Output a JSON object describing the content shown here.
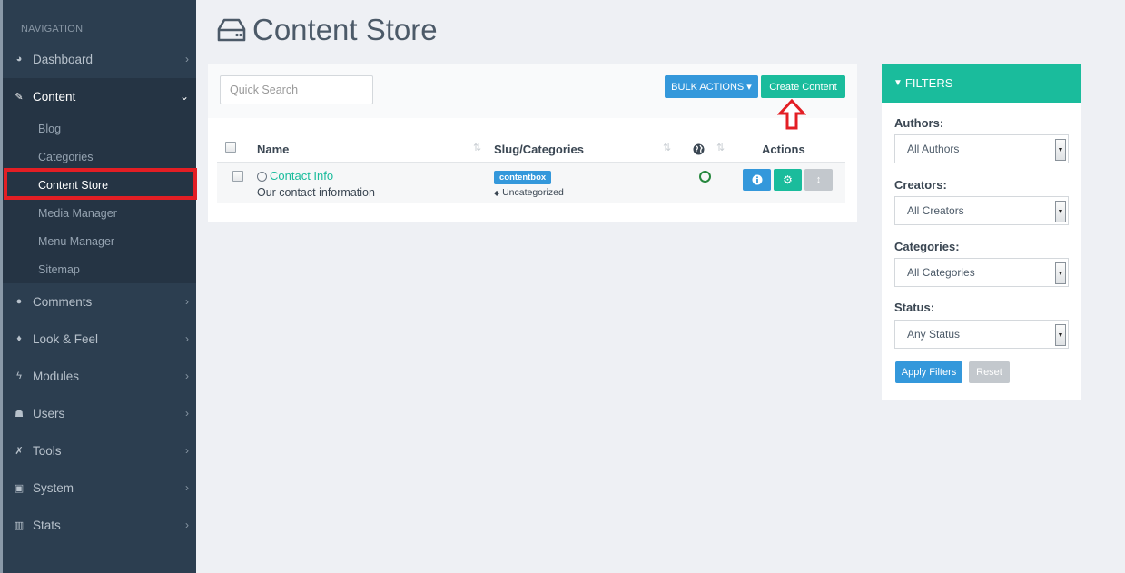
{
  "sidebar": {
    "title": "NAVIGATION",
    "items": [
      {
        "label": "Dashboard",
        "icon": "dashboard-icon",
        "glyph": "◕"
      },
      {
        "label": "Content",
        "icon": "pencil-icon",
        "glyph": "✎"
      },
      {
        "label": "Comments",
        "icon": "comment-icon",
        "glyph": "●"
      },
      {
        "label": "Look & Feel",
        "icon": "tint-icon",
        "glyph": "♦"
      },
      {
        "label": "Modules",
        "icon": "bolt-icon",
        "glyph": "ϟ"
      },
      {
        "label": "Users",
        "icon": "user-icon",
        "glyph": "☗"
      },
      {
        "label": "Tools",
        "icon": "wrench-icon",
        "glyph": "✗"
      },
      {
        "label": "System",
        "icon": "briefcase-icon",
        "glyph": "▣"
      },
      {
        "label": "Stats",
        "icon": "bar-chart-icon",
        "glyph": "▥"
      }
    ],
    "content_sub": [
      "Blog",
      "Categories",
      "Content Store",
      "Media Manager",
      "Menu Manager",
      "Sitemap"
    ]
  },
  "page": {
    "title": "Content Store",
    "title_icon": "hdd-icon"
  },
  "toolbar": {
    "search_placeholder": "Quick Search",
    "bulk_label": "BULK ACTIONS ▾",
    "create_label": "Create Content"
  },
  "table": {
    "headers": {
      "name": "Name",
      "slug": "Slug/Categories",
      "actions": "Actions"
    },
    "rows": [
      {
        "title": "Contact Info",
        "description": "Our contact information",
        "slug": "contentbox",
        "category": "Uncategorized"
      }
    ]
  },
  "filters": {
    "title": "FILTERS",
    "authors_label": "Authors:",
    "authors_value": "All Authors",
    "creators_label": "Creators:",
    "creators_value": "All Creators",
    "categories_label": "Categories:",
    "categories_value": "All Categories",
    "status_label": "Status:",
    "status_value": "Any Status",
    "apply_label": "Apply Filters",
    "reset_label": "Reset"
  },
  "colors": {
    "sidebar": "#2c3e50",
    "primary": "#3498db",
    "accent": "#1abc9c",
    "highlight": "#e31e24"
  }
}
